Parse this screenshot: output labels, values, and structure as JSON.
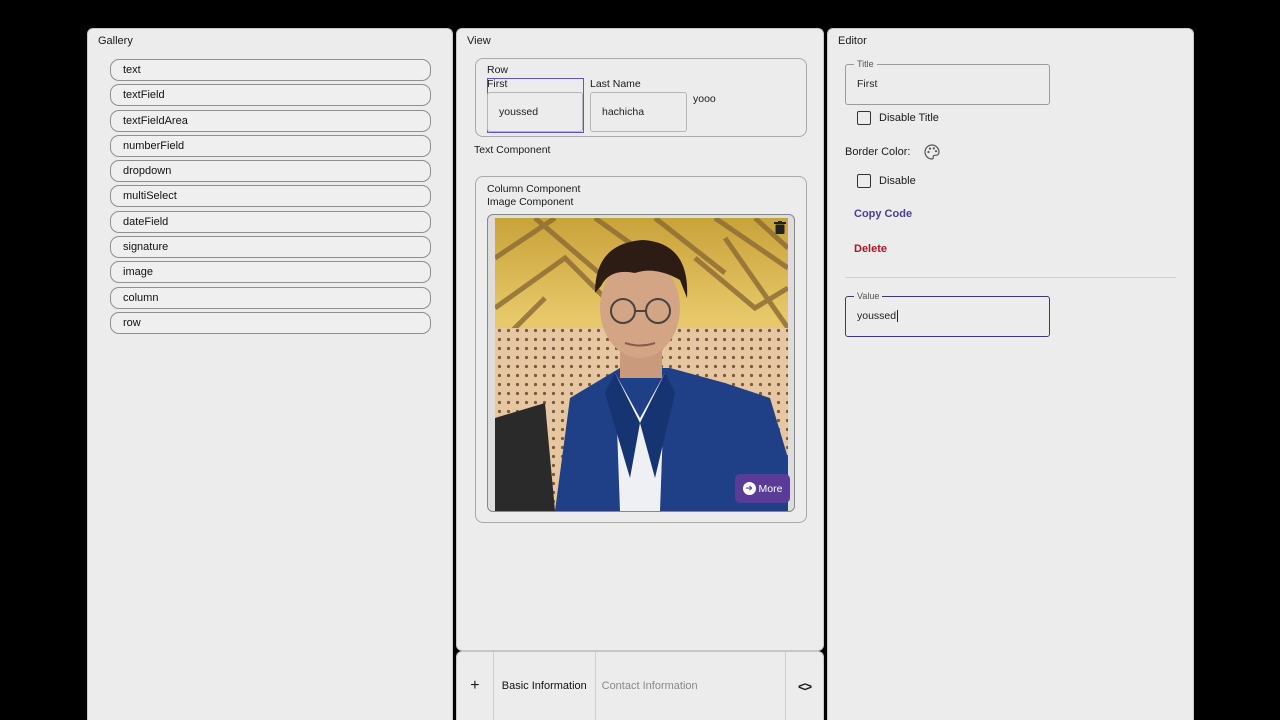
{
  "gallery": {
    "title": "Gallery",
    "items": [
      "text",
      "textField",
      "textFieldArea",
      "numberField",
      "dropdown",
      "multiSelect",
      "dateField",
      "signature",
      "image",
      "column",
      "row"
    ]
  },
  "view": {
    "title": "View",
    "row": {
      "label": "Row",
      "first_label": "First",
      "first_value": "youssed",
      "last_label": "Last Name",
      "last_value": "hachicha",
      "extra_text": "yooo"
    },
    "text_component": "Text Component",
    "column": {
      "label": "Column Component",
      "image_label": "Image Component",
      "more_label": "More"
    }
  },
  "tabs": {
    "add_icon": "+",
    "basic": "Basic Information",
    "contact": "Contact Information",
    "code_icon": "<>"
  },
  "editor": {
    "title": "Editor",
    "title_field": {
      "legend": "Title",
      "value": "First"
    },
    "disable_title_label": "Disable Title",
    "border_color_label": "Border Color:",
    "disable_label": "Disable",
    "copy_code_label": "Copy Code",
    "delete_label": "Delete",
    "value_field": {
      "legend": "Value",
      "value": "youssed"
    }
  },
  "colors": {
    "accent": "#5a3c96",
    "copy_code": "#4b3f8f",
    "delete": "#b3112a",
    "selection_outline": "#5b56c9"
  }
}
